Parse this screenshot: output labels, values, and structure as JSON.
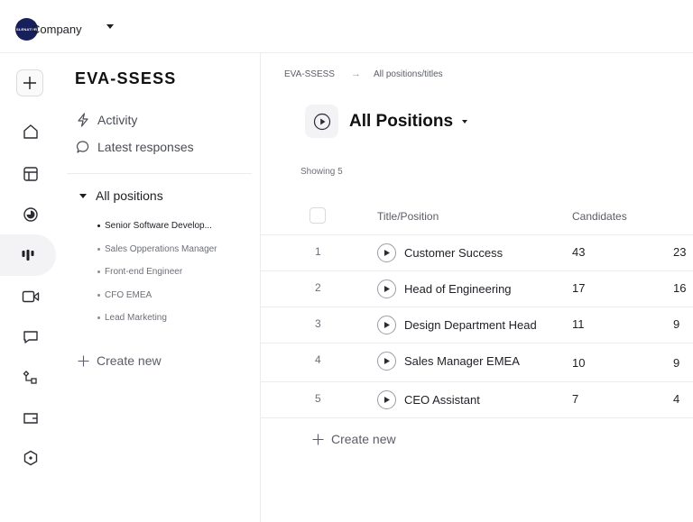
{
  "company": {
    "logo_text": "SLENATUR",
    "name": "Company"
  },
  "nav": {
    "brand": "EVA-SSESS",
    "links": [
      {
        "label": "Activity",
        "icon": "lightning-icon"
      },
      {
        "label": "Latest responses",
        "icon": "chat-bubble-icon"
      }
    ],
    "tree": {
      "root": "All positions",
      "children": [
        "Senior Software Develop...",
        "Sales Opperations Manager",
        "Front-end Engineer",
        "CFO EMEA",
        "Lead Marketing"
      ]
    },
    "create_label": "Create new"
  },
  "breadcrumb": {
    "root": "EVA-SSESS",
    "arrow": "→",
    "current": "All positions/titles"
  },
  "page": {
    "title": "All Positions",
    "showing": "Showing 5"
  },
  "table": {
    "headers": {
      "title": "Title/Position",
      "candidates": "Candidates"
    },
    "rows": [
      {
        "num": "1",
        "title": "Customer Success",
        "candidates": "43",
        "col2": "23"
      },
      {
        "num": "2",
        "title": "Head of Engineering",
        "candidates": "17",
        "col2": "16"
      },
      {
        "num": "3",
        "title": "Design Department Head",
        "candidates": "11",
        "col2": "9"
      },
      {
        "num": "4",
        "title": "Sales Manager EMEA",
        "candidates": "10",
        "col2": "9"
      },
      {
        "num": "5",
        "title": "CEO Assistant",
        "candidates": "7",
        "col2": "4"
      }
    ],
    "create_label": "Create new"
  },
  "rail_icons": [
    "plus-icon",
    "home-icon",
    "layout-icon",
    "pie-chart-icon",
    "kanban-icon",
    "video-icon",
    "messages-icon",
    "workflow-icon",
    "card-icon",
    "hexagon-icon"
  ],
  "colors": {
    "logo_bg": "#17205a",
    "active_bg": "#f3f3f5",
    "border": "#ececef"
  }
}
